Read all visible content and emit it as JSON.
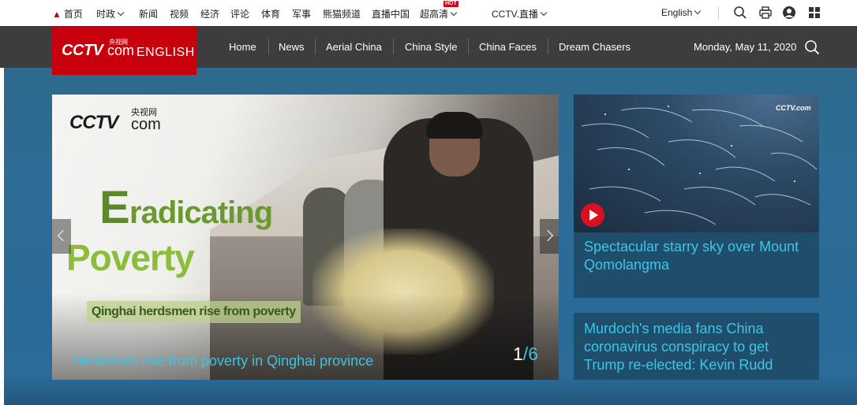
{
  "topbar": {
    "links": [
      "首页",
      "时政",
      "新闻",
      "视频",
      "经济",
      "评论",
      "体育",
      "军事",
      "熊猫频道",
      "直播中国",
      "超高清",
      "CCTV.直播"
    ],
    "hot_badge": "HOT",
    "language": "English"
  },
  "logo": {
    "brand": "CCTV",
    "brand_cn": "央视网",
    "brand_com": "com",
    "channel": "ENGLISH"
  },
  "nav": {
    "items": [
      "Home",
      "News",
      "Aerial China",
      "China Style",
      "China Faces",
      "Dream Chasers"
    ],
    "date": "Monday, May 11, 2020"
  },
  "slider": {
    "image_logo": {
      "brand": "CCTV",
      "brand_cn": "央视网",
      "brand_com": "com"
    },
    "headline_initial": "E",
    "headline_line1": "radicating",
    "headline_line2": "Poverty",
    "subheadline": "Qinghai herdsmen rise from poverty",
    "caption": "Herdsmen rise from poverty in Qinghai province",
    "current": "1",
    "separator": "/",
    "total": "6"
  },
  "side_cards": [
    {
      "title": "Spectacular starry sky over Mount Qomolangma",
      "image_logo": "CCTV.com",
      "has_video": true
    },
    {
      "title": "Murdoch's media fans China coronavirus conspiracy to get Trump re-elected: Kevin Rudd"
    }
  ],
  "colors": {
    "brand_red": "#c8000d",
    "nav_bg": "#3d3d3d",
    "accent_cyan": "#40c4e4",
    "backdrop_blue": "#2c6c96",
    "headline_green": "#6a9a2f"
  },
  "icons": [
    "home-icon",
    "chevron-down-icon",
    "search-icon",
    "print-icon",
    "user-icon",
    "grid-icon",
    "play-icon",
    "chevron-left-icon",
    "chevron-right-icon"
  ]
}
